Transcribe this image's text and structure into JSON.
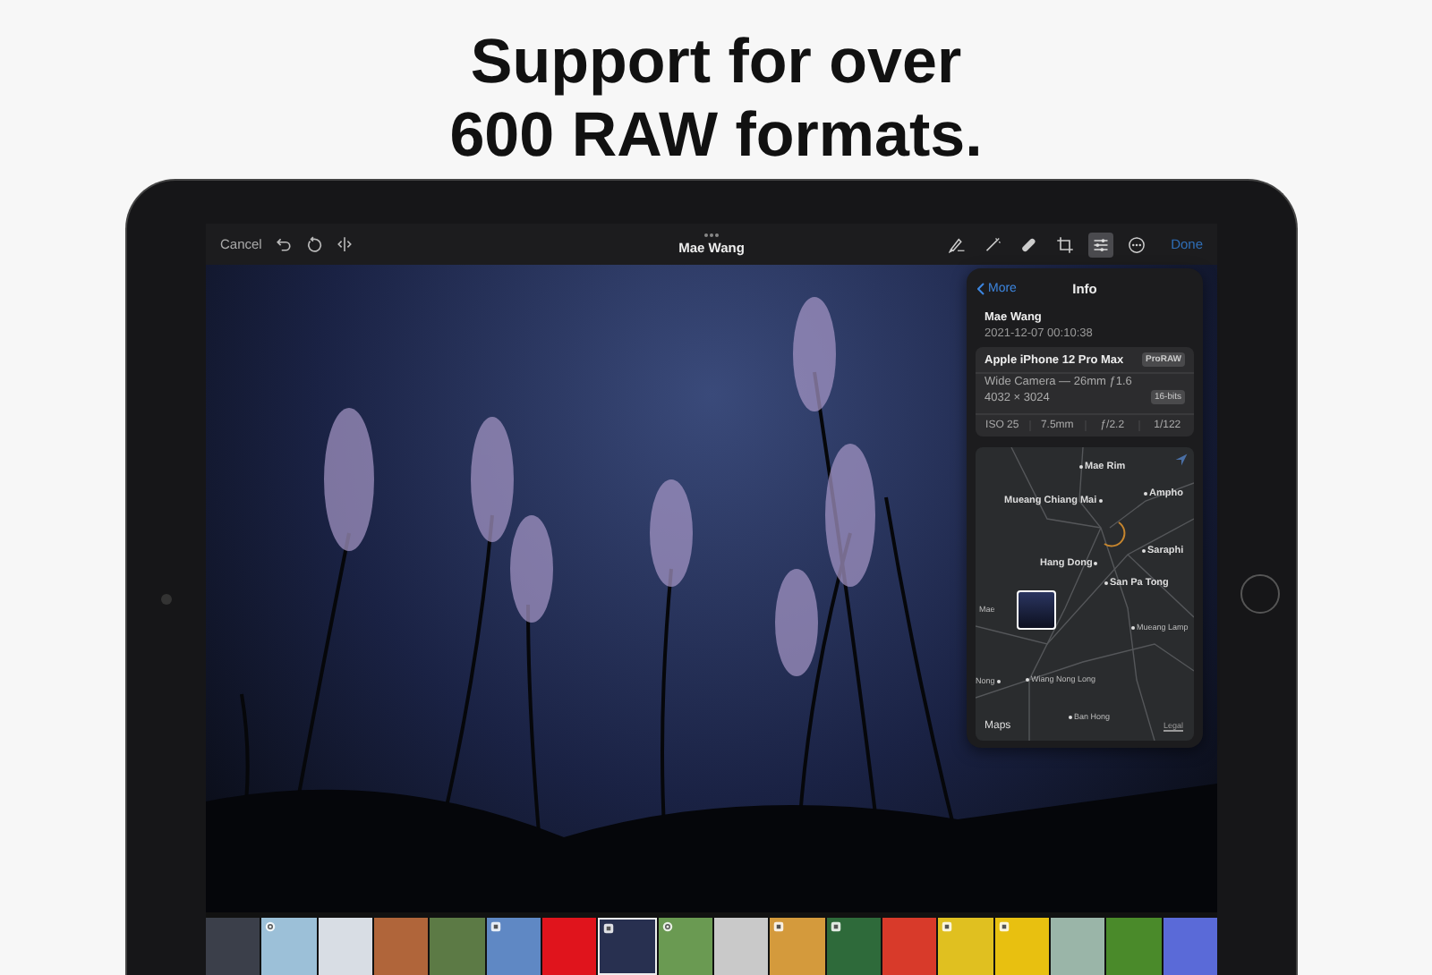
{
  "headline": [
    "Support for over",
    "600 RAW formats."
  ],
  "toolbar": {
    "cancel": "Cancel",
    "title": "Mae Wang",
    "done": "Done",
    "tools": [
      {
        "kind": "markup",
        "selected": false
      },
      {
        "kind": "auto",
        "selected": false
      },
      {
        "kind": "retouch",
        "selected": false
      },
      {
        "kind": "crop",
        "selected": false
      },
      {
        "kind": "adjust",
        "selected": true
      },
      {
        "kind": "more",
        "selected": false
      }
    ]
  },
  "info": {
    "back": "More",
    "title": "Info",
    "name": "Mae Wang",
    "date": "2021-12-07 00:10:38",
    "device": "Apple iPhone 12 Pro Max",
    "format_badge": "ProRAW",
    "lens": "Wide Camera — 26mm ƒ1.6",
    "resolution": "4032 × 3024",
    "depth_badge": "16-bits",
    "exif": [
      "ISO 25",
      "7.5mm",
      "ƒ/2.2",
      "1/122"
    ],
    "map": {
      "labels": [
        "Mae Rim",
        "Mueang Chiang Mai",
        "Ampho",
        "Saraphi",
        "Hang Dong",
        "San Pa Tong",
        "Mae",
        "Mueang Lamp",
        "Nong",
        "Wiang Nong Long",
        "Ban Hong"
      ],
      "brand": "Maps",
      "legal": "Legal"
    }
  },
  "filmstrip": [
    {
      "kind": "plain",
      "selected": false
    },
    {
      "kind": "live",
      "selected": false
    },
    {
      "kind": "plain",
      "selected": false
    },
    {
      "kind": "plain",
      "selected": false
    },
    {
      "kind": "plain",
      "selected": false
    },
    {
      "kind": "raw",
      "selected": false
    },
    {
      "kind": "plain",
      "selected": false
    },
    {
      "kind": "raw",
      "selected": true
    },
    {
      "kind": "live",
      "selected": false
    },
    {
      "kind": "plain",
      "selected": false
    },
    {
      "kind": "raw",
      "selected": false
    },
    {
      "kind": "raw",
      "selected": false
    },
    {
      "kind": "plain",
      "selected": false
    },
    {
      "kind": "raw",
      "selected": false
    },
    {
      "kind": "raw",
      "selected": false
    },
    {
      "kind": "plain",
      "selected": false
    },
    {
      "kind": "plain",
      "selected": false
    },
    {
      "kind": "plain",
      "selected": false
    }
  ]
}
